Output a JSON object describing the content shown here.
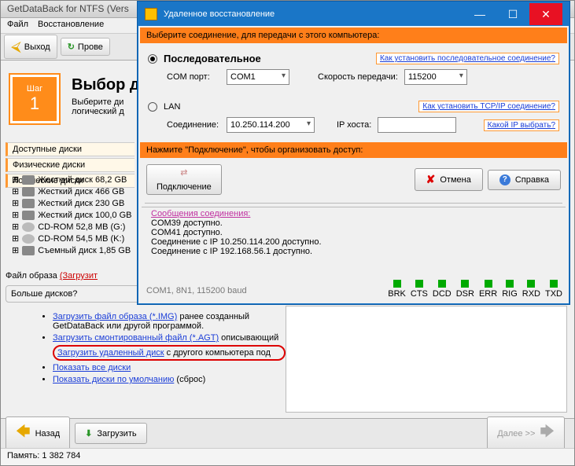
{
  "main": {
    "title": "GetDataBack for NTFS (Vers",
    "menu": [
      "Файл",
      "Восстановление"
    ],
    "toolbar": {
      "exit": "Выход",
      "check": "Прове"
    },
    "step": {
      "label": "Шаг",
      "num": "1"
    },
    "header": {
      "title": "Выбор д",
      "sub1": "Выберите ди",
      "sub2": "логический д"
    },
    "tabs": {
      "avail": "Доступные диски",
      "phys": "Физические диски",
      "log": "Логические диски"
    },
    "tree": [
      "Жесткий диск 68,2 GB",
      "Жесткий диск 466 GB",
      "Жесткий диск 230 GB",
      "Жесткий диск 100,0 GB",
      "CD-ROM 52,8 MB (G:)",
      "CD-ROM 54,5 MB (K:)",
      "Съемный диск 1,85 GB"
    ],
    "file_line_a": "Файл образа ",
    "file_line_b": "(Загрузит",
    "more": "Больше дисков?",
    "links": {
      "l1a": "Загрузить файл образа (*.IMG)",
      "l1b": " ранее созданный GetDataBack или другой программой.",
      "l2a": "Загрузить смонтированный файл (*.AGT)",
      "l2b": " описывающий",
      "l3a": "Загрузить удаленный диск",
      "l3b": " с другого компьютера под",
      "l4": "Показать все диски",
      "l5a": "Показать диски по умолчанию",
      "l5b": " (сброс)"
    },
    "bottom": {
      "back": "Назад",
      "load": "Загрузить",
      "next": "Далее >>"
    },
    "status": "Память: 1 382 784"
  },
  "dlg": {
    "title": "Удаленное восстановление",
    "h_select": "Выберите соединение, для передачи с этого компьютера:",
    "serial": {
      "label": "Последовательное",
      "com_lbl": "COM порт:",
      "com_val": "COM1",
      "speed_lbl": "Скорость передачи:",
      "speed_val": "115200",
      "hint": "Как установить последовательное соединение?"
    },
    "lan": {
      "label": "LAN",
      "conn_lbl": "Соединение:",
      "conn_val": "10.250.114.200",
      "host_lbl": "IP хоста:",
      "host_val": "",
      "hint": "Как установить TCP/IP соединение?",
      "hint2": "Какой IP выбрать?"
    },
    "h_press": "Нажмите \"Подключение\", чтобы организовать доступ:",
    "btn": {
      "connect": "Подключение",
      "cancel": "Отмена",
      "help": "Справка"
    },
    "msgs": {
      "hd": "Сообщения соединения:",
      "l1": "COM39 доступно.",
      "l2": "COM41 доступно.",
      "l3": "Соединение с IP 10.250.114.200 доступно.",
      "l4": "Соединение с IP 192.168.56.1 доступно."
    },
    "baud": "COM1, 8N1, 115200 baud",
    "leds": [
      "BRK",
      "CTS",
      "DCD",
      "DSR",
      "ERR",
      "RIG",
      "RXD",
      "TXD"
    ]
  }
}
